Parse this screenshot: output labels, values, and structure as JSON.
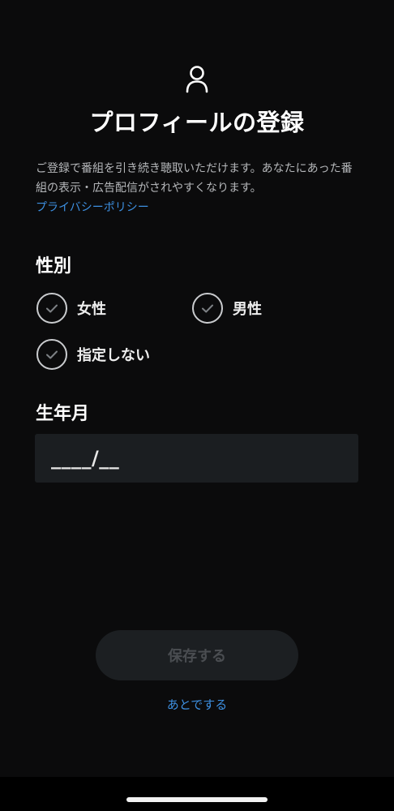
{
  "header": {
    "icon": "person-outline-icon",
    "title": "プロフィールの登録"
  },
  "intro": {
    "description": "ご登録で番組を引き続き聴取いただけます。あなたにあった番組の表示・広告配信がされやすくなります。",
    "privacy_link": "プライバシーポリシー"
  },
  "gender": {
    "label": "性別",
    "options": [
      {
        "label": "女性",
        "icon": "check-circle-icon"
      },
      {
        "label": "男性",
        "icon": "check-circle-icon"
      },
      {
        "label": "指定しない",
        "icon": "check-circle-icon"
      }
    ]
  },
  "birth": {
    "label": "生年月",
    "placeholder": "____/__"
  },
  "actions": {
    "save_label": "保存する",
    "later_label": "あとでする"
  },
  "colors": {
    "background": "#0b0b0c",
    "link": "#3d8fe0",
    "field": "#1b1e21",
    "button_disabled": "#1c1f22"
  }
}
